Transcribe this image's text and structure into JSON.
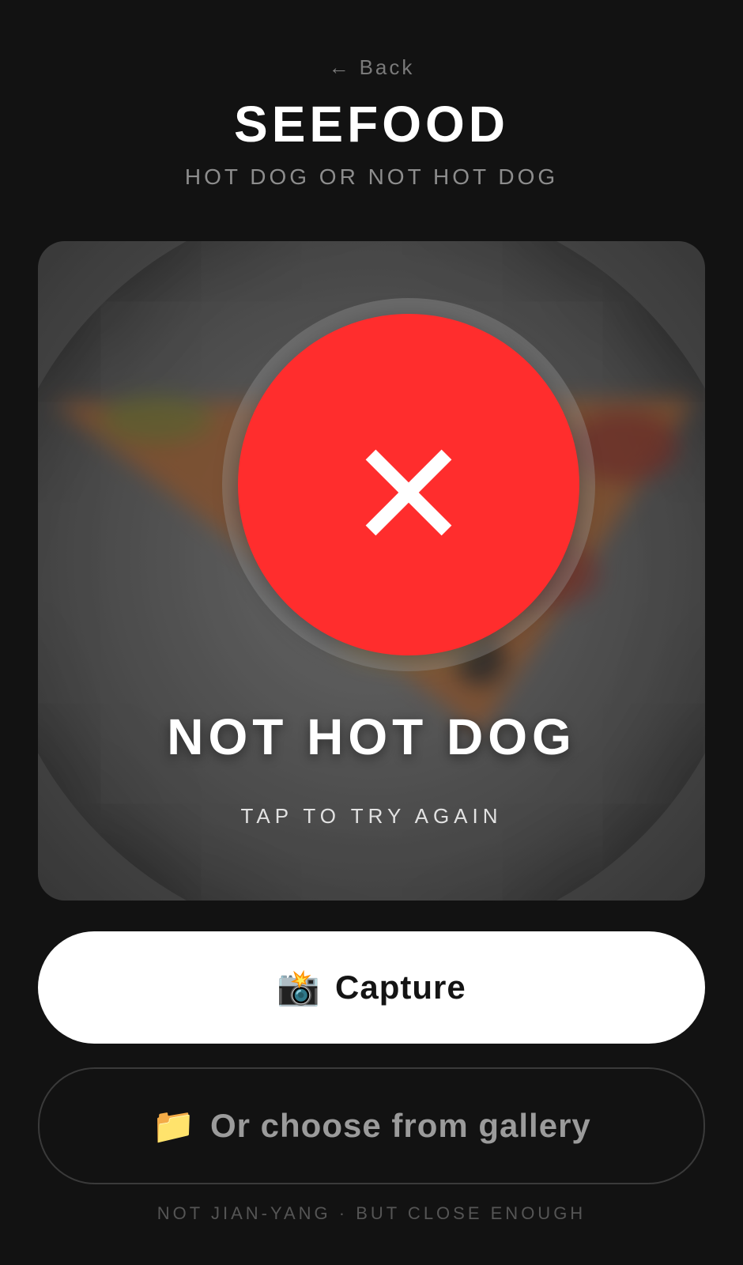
{
  "header": {
    "back_arrow": "←",
    "back_label": "Back",
    "title": "SEEFOOD",
    "subtitle": "HOT DOG OR NOT HOT DOG"
  },
  "result": {
    "verdict": "NOT HOT DOG",
    "verdict_icon": "close-icon",
    "verdict_color": "#ff2d2d",
    "hint": "TAP TO TRY AGAIN"
  },
  "actions": {
    "capture_emoji": "📸",
    "capture_label": "Capture",
    "gallery_emoji": "📁",
    "gallery_label": "Or choose from gallery"
  },
  "footer": {
    "text": "NOT JIAN-YANG · BUT CLOSE ENOUGH"
  }
}
